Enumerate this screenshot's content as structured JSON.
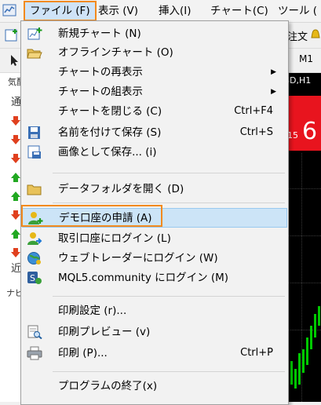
{
  "menubar": {
    "items": [
      {
        "label": "ファイル (F)"
      },
      {
        "label": "表示 (V)"
      },
      {
        "label": "挿入(I)"
      },
      {
        "label": "チャート(C)"
      },
      {
        "label": "ツール ("
      }
    ]
  },
  "toolbar": {
    "partial_label": "注文",
    "timeframe": "M1"
  },
  "left_panel": {
    "header": "気配",
    "tab_label": "通",
    "bottom_label": "近",
    "navigator_label": "ナビ"
  },
  "chart": {
    "title": "SD,H1",
    "price_small": "15",
    "price_big": "6",
    "colors": {
      "bg": "#000000",
      "price_box": "#e8141e",
      "candles": "#00c800"
    }
  },
  "file_menu": {
    "items": [
      {
        "label": "新規チャート (N)",
        "shortcut": "",
        "icon": "new-chart-icon"
      },
      {
        "label": "オフラインチャート (O)",
        "shortcut": "",
        "icon": "folder-open-icon"
      },
      {
        "label": "チャートの再表示",
        "shortcut": "",
        "icon": "",
        "submenu": "▶"
      },
      {
        "label": "チャートの組表示",
        "shortcut": "",
        "icon": "",
        "submenu": "▶"
      },
      {
        "label": "チャートを閉じる (C)",
        "shortcut": "Ctrl+F4",
        "icon": ""
      },
      {
        "label": "名前を付けて保存 (S)",
        "shortcut": "Ctrl+S",
        "icon": "save-icon"
      },
      {
        "label": "画像として保存... (i)",
        "shortcut": "",
        "icon": "save-image-icon"
      },
      {
        "label": "データフォルダを開く (D)",
        "shortcut": "",
        "icon": "folder-icon"
      },
      {
        "label": "デモ口座の申請 (A)",
        "shortcut": "",
        "icon": "add-user-icon"
      },
      {
        "label": "取引口座にログイン (L)",
        "shortcut": "",
        "icon": "login-icon"
      },
      {
        "label": "ウェブトレーダーにログイン (W)",
        "shortcut": "",
        "icon": "globe-icon"
      },
      {
        "label": "MQL5.community にログイン (M)",
        "shortcut": "",
        "icon": "mql5-icon"
      },
      {
        "label": "印刷設定 (r)...",
        "shortcut": "",
        "icon": ""
      },
      {
        "label": "印刷プレビュー (v)",
        "shortcut": "",
        "icon": "print-preview-icon"
      },
      {
        "label": "印刷 (P)...",
        "shortcut": "Ctrl+P",
        "icon": "printer-icon"
      },
      {
        "label": "プログラムの終了(x)",
        "shortcut": "",
        "icon": ""
      }
    ]
  }
}
